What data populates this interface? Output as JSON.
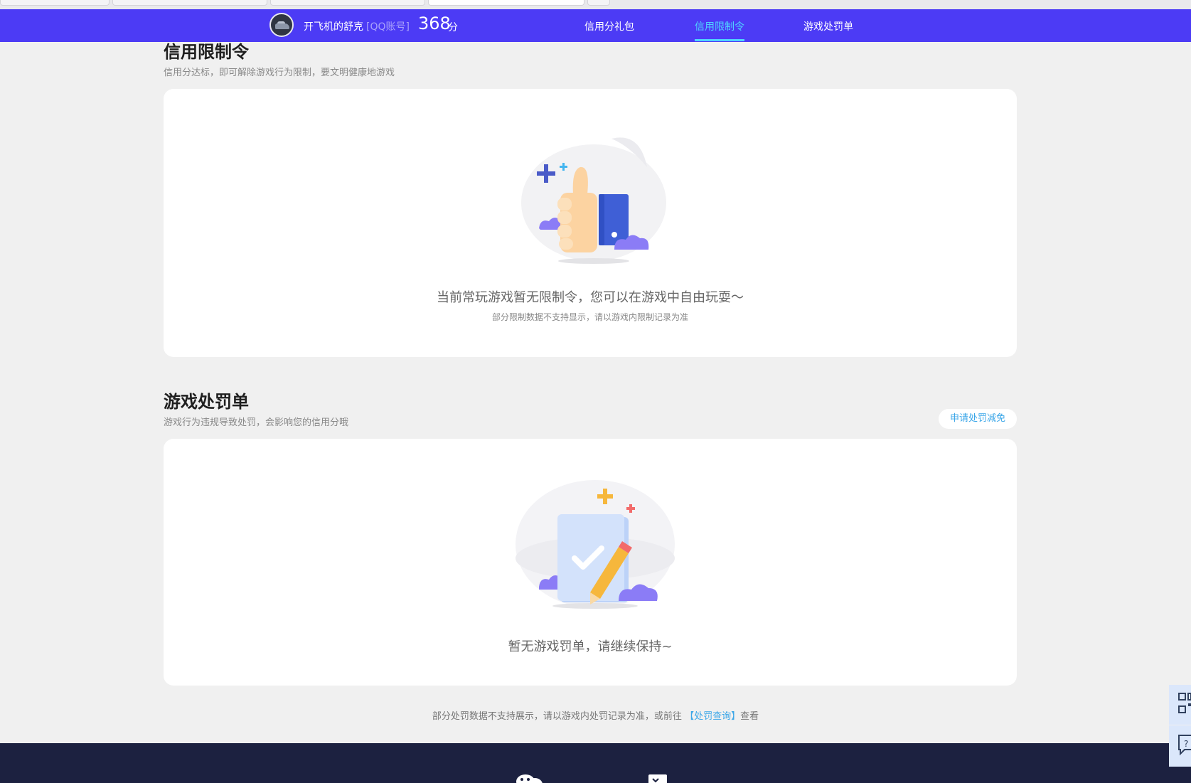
{
  "header": {
    "username": "开飞机的舒克",
    "account_type": "[QQ账号]",
    "score": "368",
    "score_unit": "分",
    "tabs": [
      {
        "label": "信用分礼包",
        "active": false
      },
      {
        "label": "信用限制令",
        "active": true
      },
      {
        "label": "游戏处罚单",
        "active": false
      }
    ]
  },
  "restriction": {
    "title": "信用限制令",
    "subtitle": "信用分达标，即可解除游戏行为限制，要文明健康地游戏",
    "empty_text": "当前常玩游戏暂无限制令，您可以在游戏中自由玩耍～",
    "note": "部分限制数据不支持显示，请以游戏内限制记录为准"
  },
  "penalty": {
    "title": "游戏处罚单",
    "subtitle": "游戏行为违规导致处罚，会影响您的信用分哦",
    "apply_button": "申请处罚减免",
    "empty_text": "暂无游戏罚单，请继续保持~"
  },
  "bottom_note": {
    "prefix": "部分处罚数据不支持展示，请以游戏内处罚记录为准，或前往",
    "link": "【处罚查询】",
    "suffix": "查看"
  },
  "icons": {
    "illus_restriction": "thumbs-up-illustration",
    "illus_penalty": "checklist-pencil-illustration",
    "footer_wechat": "wechat-icon",
    "footer_qq": "qq-icon",
    "side_qr": "qrcode-icon",
    "side_help": "help-chat-icon"
  },
  "colors": {
    "nav_bg": "#4c3bf5",
    "accent": "#4fd3ff",
    "link": "#3aa6e8",
    "footer_bg": "#1c2140"
  }
}
